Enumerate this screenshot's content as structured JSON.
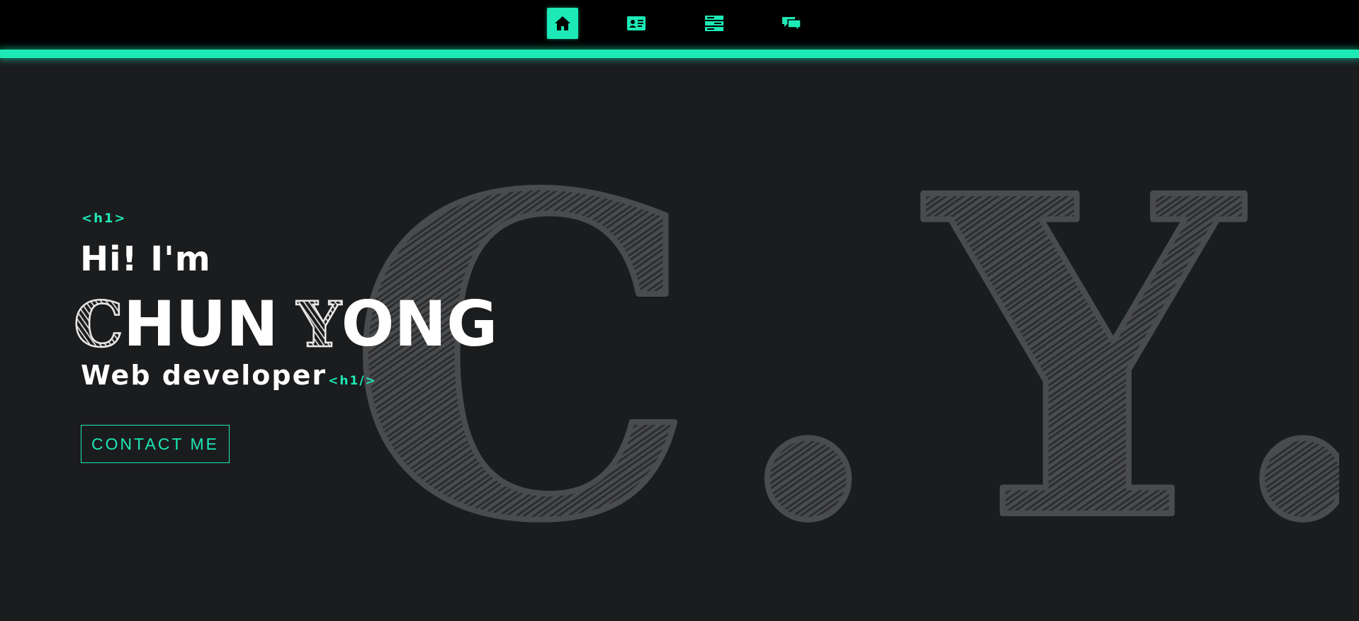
{
  "colors": {
    "accent": "#1de9b6",
    "background": "#1b1c1e",
    "topbar": "#000000",
    "text": "#ffffff",
    "sketch": "#4a4b4d"
  },
  "nav": {
    "items": [
      {
        "icon": "home-icon",
        "active": true
      },
      {
        "icon": "id-card-icon",
        "active": false
      },
      {
        "icon": "server-stack-icon",
        "active": false
      },
      {
        "icon": "chat-bubbles-icon",
        "active": false
      }
    ]
  },
  "hero": {
    "tag_open": "<h1>",
    "greeting": "Hi! I'm",
    "name": {
      "first_initial": "C",
      "first_rest": "HUN",
      "last_initial": "Y",
      "last_rest": "ONG"
    },
    "role": "Web developer",
    "tag_close": "<h1/>",
    "cta_label": "CONTACT ME"
  },
  "background_art": {
    "text": "C.Y."
  }
}
